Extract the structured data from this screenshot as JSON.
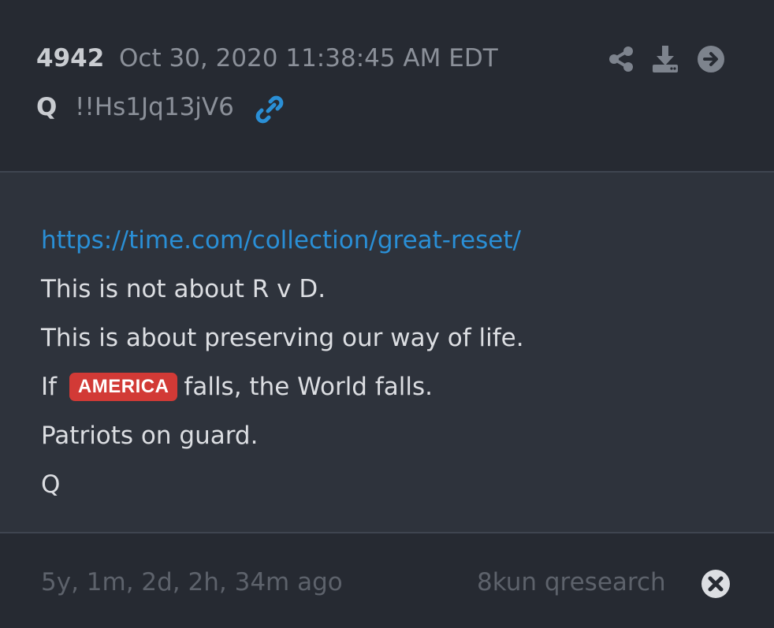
{
  "post": {
    "number": "4942",
    "timestamp": "Oct 30, 2020 11:38:45 AM EDT",
    "author": "Q",
    "tripcode": "!!Hs1Jq13jV6"
  },
  "actions": {
    "icons": [
      "share-icon",
      "download-icon",
      "arrow-right-circle-icon"
    ]
  },
  "body": {
    "url": "https://time.com/collection/great-reset/",
    "line2": "This is not about R v D.",
    "line3": "This is about preserving our way of life.",
    "line4_prefix": "If",
    "line4_badge": "AMERICA",
    "line4_suffix": "falls, the World falls.",
    "line5": "Patriots on guard.",
    "line6": "Q"
  },
  "footer": {
    "age": "5y, 1m, 2d, 2h, 34m ago",
    "source": "8kun qresearch"
  },
  "colors": {
    "background": "#262a32",
    "body_background": "#2e333c",
    "link": "#2a8fd6",
    "badge": "#d23a36"
  }
}
